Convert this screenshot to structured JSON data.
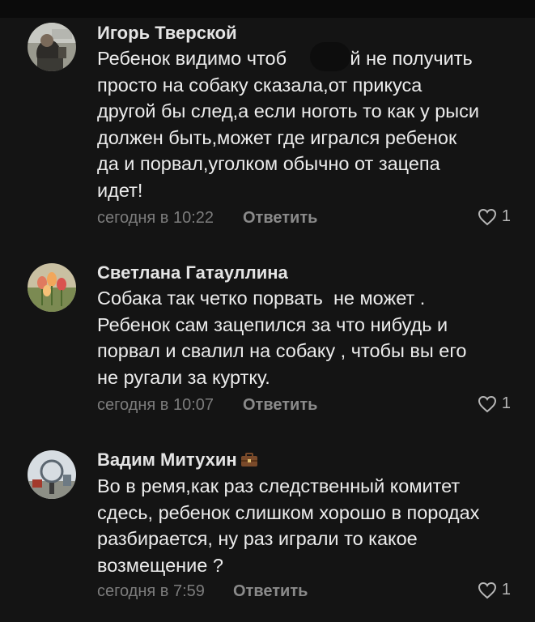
{
  "comments": [
    {
      "author": "Игорь Тверской",
      "lines": [
        "Ребенок видимо чтоб          ей не получить",
        "просто на собаку сказала,от прикуса",
        "другой бы след,а если ноготь то как у рыси",
        "должен быть,может где игрался ребенок",
        "да и порвал,уголком обычно от зацепа",
        "идет!"
      ],
      "time": "сегодня в 10:22",
      "reply_label": "Ответить",
      "likes": "1"
    },
    {
      "author": "Светлана Гатауллина",
      "lines": [
        "Собака так четко порвать  не может .",
        "Ребенок сам зацепился за что нибудь и",
        "порвал и свалил на собаку , чтобы вы его",
        "не ругали за куртку."
      ],
      "time": "сегодня в 10:07",
      "reply_label": "Ответить",
      "likes": "1"
    },
    {
      "author": "Вадим Митухин",
      "lines": [
        "Во в ремя,как раз следственный комитет",
        "сдесь, ребенок слишком хорошо в породах",
        "разбирается, ну раз играли то какое",
        "возмещение ?"
      ],
      "time": "сегодня в 7:59",
      "reply_label": "Ответить",
      "likes": "1"
    }
  ],
  "icons": {
    "like": "heart-outline-icon",
    "badge": "briefcase-icon"
  },
  "colors": {
    "background": "#141414",
    "text": "#ececec",
    "meta": "#7c7c7c"
  }
}
